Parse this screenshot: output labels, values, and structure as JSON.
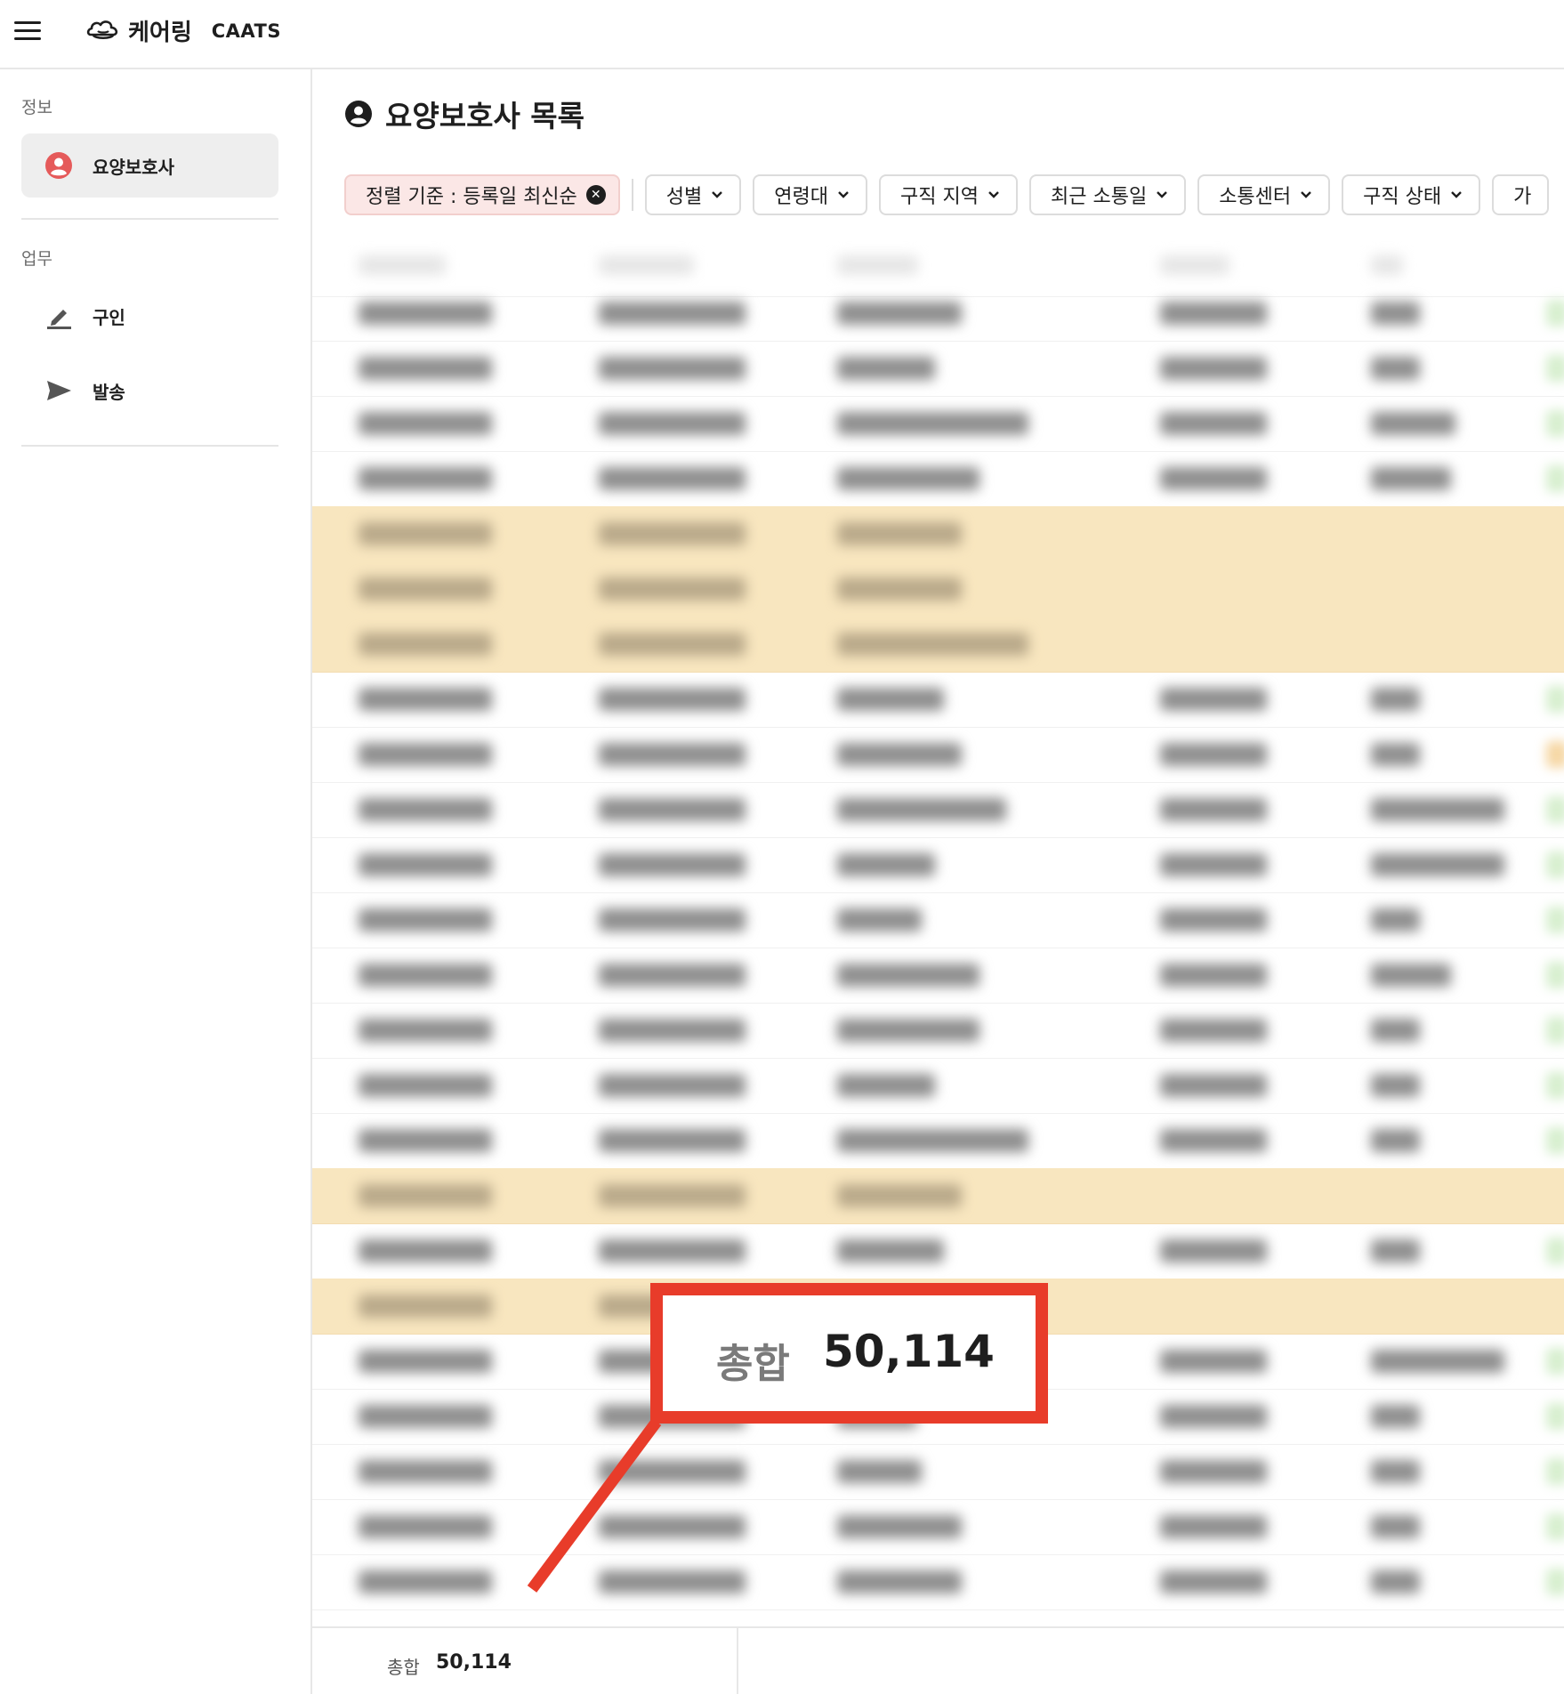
{
  "topbar": {
    "brand_name": "케어링",
    "brand_sub": "CAATS"
  },
  "sidebar": {
    "sections": [
      {
        "label": "정보",
        "items": [
          {
            "label": "요양보호사",
            "icon": "person-circle-icon",
            "active": true
          }
        ]
      },
      {
        "label": "업무",
        "items": [
          {
            "label": "구인",
            "icon": "pencil-icon",
            "active": false
          },
          {
            "label": "발송",
            "icon": "send-icon",
            "active": false
          }
        ]
      }
    ]
  },
  "main": {
    "title": "요양보호사 목록",
    "filters": {
      "sort_label": "정렬 기준 : 등록일 최신순",
      "dropdowns": [
        "성별",
        "연령대",
        "구직 지역",
        "최근 소통일",
        "소통센터",
        "구직 상태",
        "가"
      ]
    }
  },
  "footer": {
    "total_label": "총합",
    "total_value": "50,114"
  },
  "callout": {
    "label": "총합",
    "value": "50,114"
  },
  "colors": {
    "accent_red": "#e83c2a",
    "highlight_row": "#f8e6bf",
    "sort_chip_bg": "#fbe7e6",
    "status_green": "#d7efcf",
    "status_orange": "#f6d7a4"
  }
}
